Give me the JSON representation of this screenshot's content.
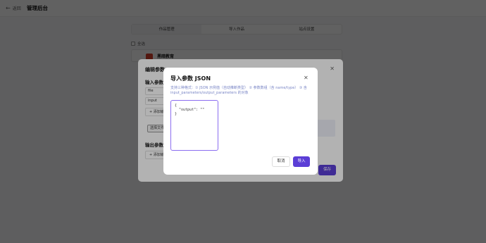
{
  "topbar": {
    "back_label": "返回",
    "back_icon": "arrow-left-icon",
    "title": "管理后台"
  },
  "tabs": [
    {
      "label": "作品管理",
      "active": true
    },
    {
      "label": "导入作品",
      "active": false
    },
    {
      "label": "站点设置",
      "active": false
    }
  ],
  "list": {
    "select_all_label": "全选",
    "item_title": "黑暗教育"
  },
  "edit_dialog": {
    "title": "编辑参数",
    "input_section": "输入参数",
    "input_values": [
      "file",
      "input"
    ],
    "add_input_label": "+ 添加输",
    "select_file_label": "选择文件",
    "output_section": "输出参数",
    "add_output_label": "+ 添加输",
    "save_label": "保存"
  },
  "import_dialog": {
    "title": "导入参数 JSON",
    "hint": "支持三种格式：① JSON 示例值（自动推断类型） ② 参数数组（含 name/type） ③ 含 input_parameters/output_parameters 的对象",
    "json_value": "{\n  \"output\": \"\"\n}",
    "cancel_label": "取消",
    "import_label": "导入"
  },
  "colors": {
    "primary": "#5b3ed6",
    "focus_border": "#8b6df0",
    "hint_text": "#7a86c6"
  }
}
